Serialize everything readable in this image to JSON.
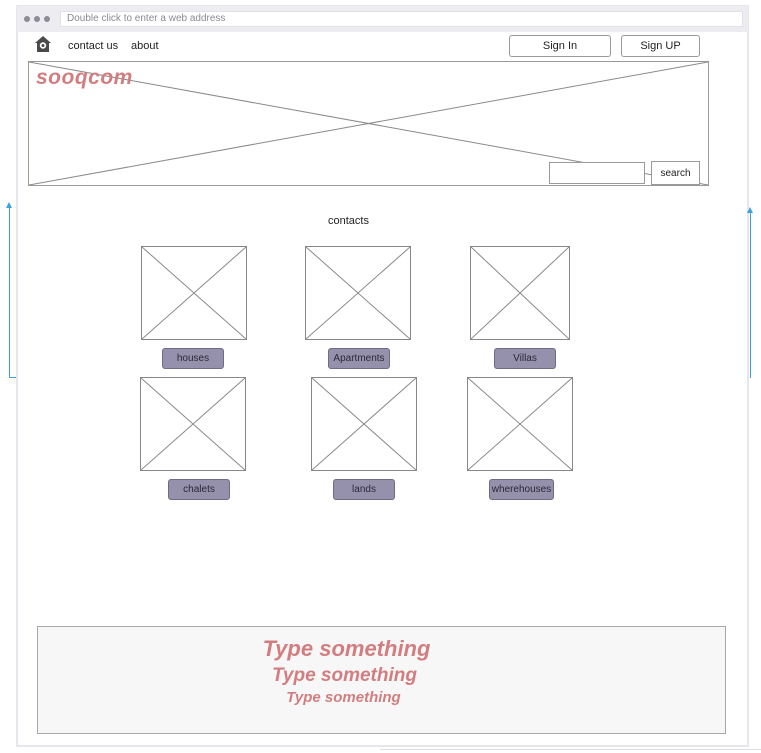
{
  "browser": {
    "address_placeholder": "Double click to enter a web address"
  },
  "nav": {
    "home_icon": "home-icon",
    "links": [
      "contact us",
      "about"
    ],
    "sign_in": "Sign In",
    "sign_up": "Sign UP"
  },
  "hero": {
    "logo": "sooqcom",
    "search_button": "search",
    "search_value": ""
  },
  "contacts": {
    "title": "contacts",
    "categories": [
      "houses",
      "Apartments",
      "Villas",
      "chalets",
      "lands",
      "wherehouses"
    ]
  },
  "footer": {
    "lines": [
      "Type something",
      "Type something",
      "Type something"
    ]
  },
  "colors": {
    "accent": "#d27e80",
    "category_button": "#9590ab",
    "connector": "#3aa3dc"
  }
}
